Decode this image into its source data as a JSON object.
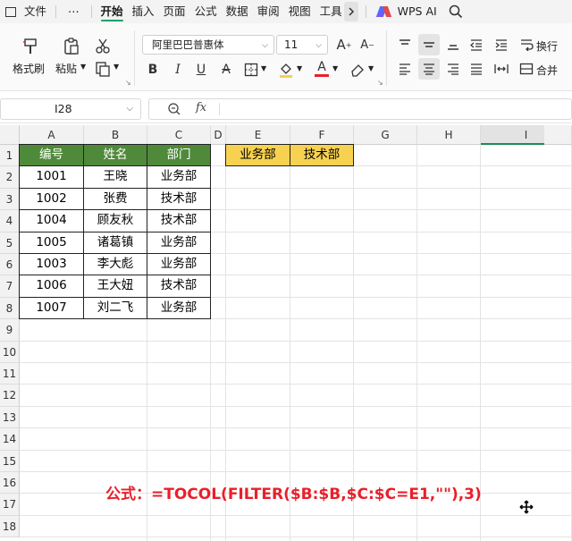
{
  "menubar": {
    "file": "文件",
    "more": "⋯",
    "tabs": [
      "开始",
      "插入",
      "页面",
      "公式",
      "数据",
      "审阅",
      "视图",
      "工具"
    ],
    "wps_ai": "WPS AI"
  },
  "ribbon": {
    "format_painter": "格式刷",
    "paste": "粘贴",
    "font_name": "阿里巴巴普惠体",
    "font_size": "11",
    "wrap": "换行",
    "merge": "合并",
    "font_color": "#e8202a"
  },
  "formula_bar": {
    "cell_ref": "I28",
    "fx": "fx",
    "content": ""
  },
  "grid": {
    "columns": [
      "A",
      "B",
      "C",
      "D",
      "E",
      "F",
      "G",
      "H",
      "I"
    ],
    "selected_column": "I",
    "rows": [
      "1",
      "2",
      "3",
      "4",
      "5",
      "6",
      "7",
      "8",
      "9",
      "10",
      "11",
      "12",
      "13",
      "14",
      "15",
      "16",
      "17",
      "18"
    ],
    "table_headers": [
      "编号",
      "姓名",
      "部门"
    ],
    "table_rows": [
      [
        "1001",
        "王晓",
        "业务部"
      ],
      [
        "1002",
        "张费",
        "技术部"
      ],
      [
        "1004",
        "顾友秋",
        "技术部"
      ],
      [
        "1005",
        "诸葛镇",
        "业务部"
      ],
      [
        "1003",
        "李大彪",
        "业务部"
      ],
      [
        "1006",
        "王大妞",
        "技术部"
      ],
      [
        "1007",
        "刘二飞",
        "业务部"
      ]
    ],
    "criteria": [
      "业务部",
      "技术部"
    ],
    "header_color": "#4f8a3a",
    "criteria_color": "#f7d150"
  },
  "annotation": "公式：=TOCOL(FILTER($B:$B,$C:$C=E1,\"\"),3)"
}
